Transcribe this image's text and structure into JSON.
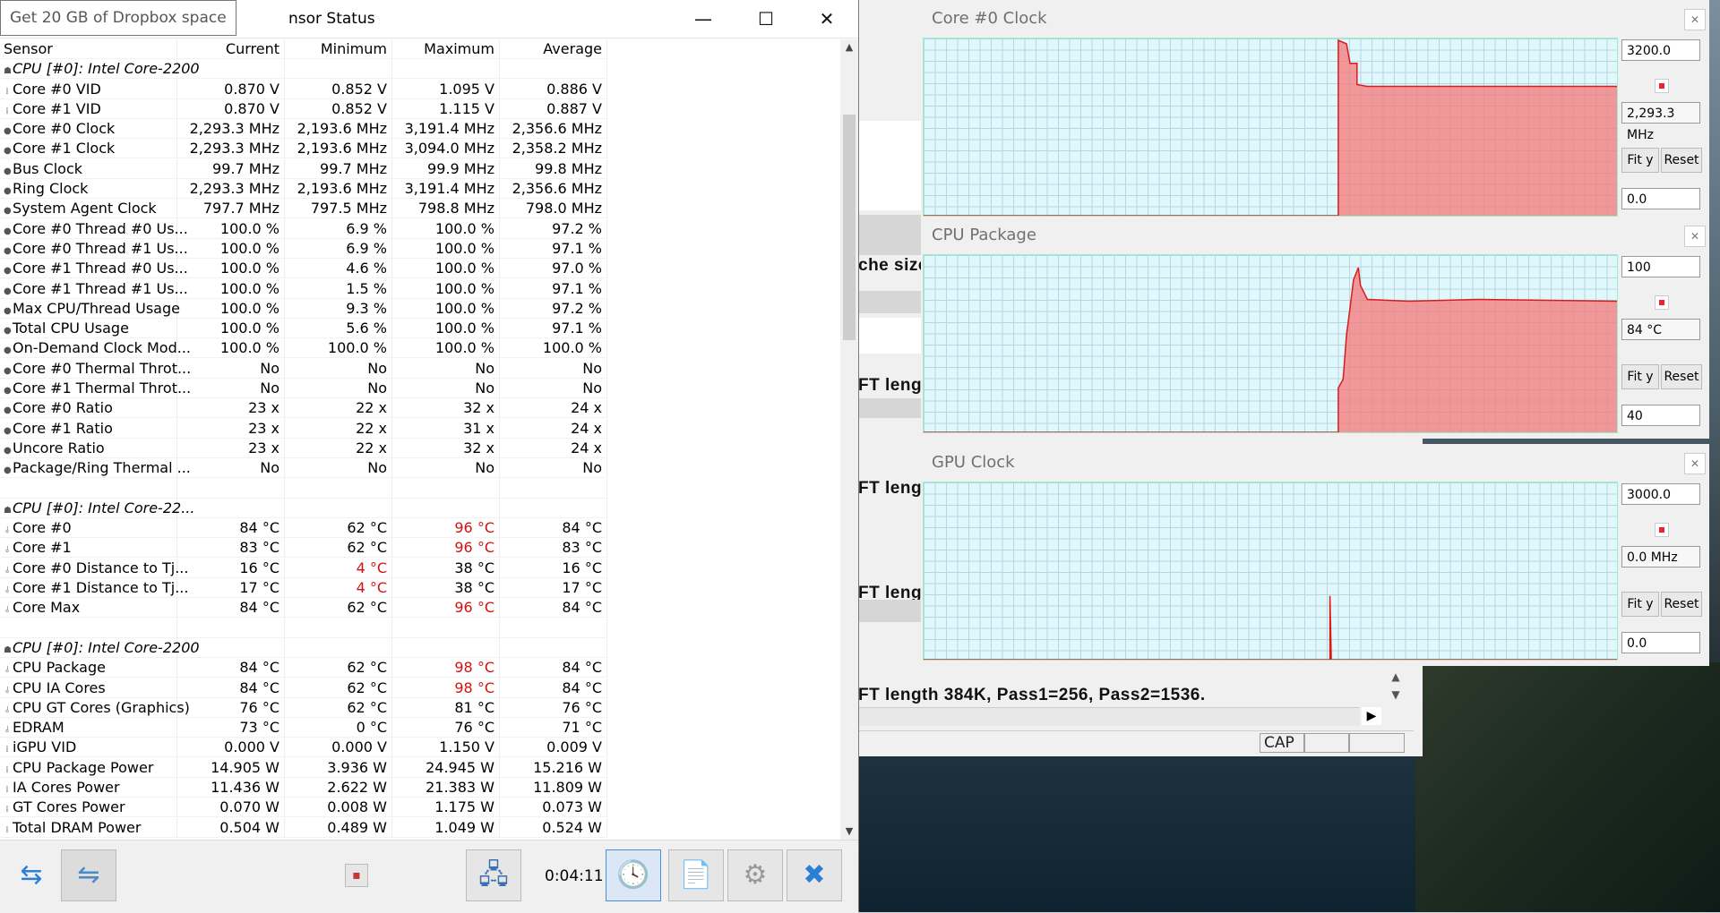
{
  "tooltip": "Get 20 GB of Dropbox space",
  "window_title": "nsor Status",
  "window_buttons": {
    "minimize": "—",
    "maximize": "☐",
    "close": "✕"
  },
  "columns": [
    "Sensor",
    "Current",
    "Minimum",
    "Maximum",
    "Average"
  ],
  "rows": [
    {
      "type": "group",
      "sensor": "CPU [#0]: Intel Core-2200",
      "current": "",
      "minimum": "",
      "maximum": "",
      "average": ""
    },
    {
      "type": "v",
      "sensor": "Core #0 VID",
      "current": "0.870 V",
      "minimum": "0.852 V",
      "maximum": "1.095 V",
      "average": "0.886 V"
    },
    {
      "type": "v",
      "sensor": "Core #1 VID",
      "current": "0.870 V",
      "minimum": "0.852 V",
      "maximum": "1.115 V",
      "average": "0.887 V"
    },
    {
      "type": "c",
      "sensor": "Core #0 Clock",
      "current": "2,293.3 MHz",
      "minimum": "2,193.6 MHz",
      "maximum": "3,191.4 MHz",
      "average": "2,356.6 MHz"
    },
    {
      "type": "c",
      "sensor": "Core #1 Clock",
      "current": "2,293.3 MHz",
      "minimum": "2,193.6 MHz",
      "maximum": "3,094.0 MHz",
      "average": "2,358.2 MHz"
    },
    {
      "type": "c",
      "sensor": "Bus Clock",
      "current": "99.7 MHz",
      "minimum": "99.7 MHz",
      "maximum": "99.9 MHz",
      "average": "99.8 MHz"
    },
    {
      "type": "c",
      "sensor": "Ring Clock",
      "current": "2,293.3 MHz",
      "minimum": "2,193.6 MHz",
      "maximum": "3,191.4 MHz",
      "average": "2,356.6 MHz"
    },
    {
      "type": "c",
      "sensor": "System Agent Clock",
      "current": "797.7 MHz",
      "minimum": "797.5 MHz",
      "maximum": "798.8 MHz",
      "average": "798.0 MHz"
    },
    {
      "type": "c",
      "sensor": "Core #0 Thread #0 Us...",
      "current": "100.0 %",
      "minimum": "6.9 %",
      "maximum": "100.0 %",
      "average": "97.2 %"
    },
    {
      "type": "c",
      "sensor": "Core #0 Thread #1 Us...",
      "current": "100.0 %",
      "minimum": "6.9 %",
      "maximum": "100.0 %",
      "average": "97.1 %"
    },
    {
      "type": "c",
      "sensor": "Core #1 Thread #0 Us...",
      "current": "100.0 %",
      "minimum": "4.6 %",
      "maximum": "100.0 %",
      "average": "97.0 %"
    },
    {
      "type": "c",
      "sensor": "Core #1 Thread #1 Us...",
      "current": "100.0 %",
      "minimum": "1.5 %",
      "maximum": "100.0 %",
      "average": "97.1 %"
    },
    {
      "type": "c",
      "sensor": "Max CPU/Thread Usage",
      "current": "100.0 %",
      "minimum": "9.3 %",
      "maximum": "100.0 %",
      "average": "97.2 %"
    },
    {
      "type": "c",
      "sensor": "Total CPU Usage",
      "current": "100.0 %",
      "minimum": "5.6 %",
      "maximum": "100.0 %",
      "average": "97.1 %"
    },
    {
      "type": "c",
      "sensor": "On-Demand Clock Mod...",
      "current": "100.0 %",
      "minimum": "100.0 %",
      "maximum": "100.0 %",
      "average": "100.0 %"
    },
    {
      "type": "c",
      "sensor": "Core #0 Thermal Throt...",
      "current": "No",
      "minimum": "No",
      "maximum": "No",
      "average": "No"
    },
    {
      "type": "c",
      "sensor": "Core #1 Thermal Throt...",
      "current": "No",
      "minimum": "No",
      "maximum": "No",
      "average": "No"
    },
    {
      "type": "c",
      "sensor": "Core #0 Ratio",
      "current": "23 x",
      "minimum": "22 x",
      "maximum": "32 x",
      "average": "24 x"
    },
    {
      "type": "c",
      "sensor": "Core #1 Ratio",
      "current": "23 x",
      "minimum": "22 x",
      "maximum": "31 x",
      "average": "24 x"
    },
    {
      "type": "c",
      "sensor": "Uncore Ratio",
      "current": "23 x",
      "minimum": "22 x",
      "maximum": "32 x",
      "average": "24 x"
    },
    {
      "type": "c",
      "sensor": "Package/Ring Thermal ...",
      "current": "No",
      "minimum": "No",
      "maximum": "No",
      "average": "No"
    },
    {
      "type": "blank",
      "sensor": "",
      "current": "",
      "minimum": "",
      "maximum": "",
      "average": ""
    },
    {
      "type": "group",
      "sensor": "CPU [#0]: Intel Core-22...",
      "current": "",
      "minimum": "",
      "maximum": "",
      "average": ""
    },
    {
      "type": "t",
      "sensor": "Core #0",
      "current": "84 °C",
      "minimum": "62 °C",
      "maximum": "96 °C",
      "average": "84 °C",
      "red": [
        "maximum"
      ]
    },
    {
      "type": "t",
      "sensor": "Core #1",
      "current": "83 °C",
      "minimum": "62 °C",
      "maximum": "96 °C",
      "average": "83 °C",
      "red": [
        "maximum"
      ]
    },
    {
      "type": "t",
      "sensor": "Core #0 Distance to Tj...",
      "current": "16 °C",
      "minimum": "4 °C",
      "maximum": "38 °C",
      "average": "16 °C",
      "red": [
        "minimum"
      ]
    },
    {
      "type": "t",
      "sensor": "Core #1 Distance to Tj...",
      "current": "17 °C",
      "minimum": "4 °C",
      "maximum": "38 °C",
      "average": "17 °C",
      "red": [
        "minimum"
      ]
    },
    {
      "type": "t",
      "sensor": "Core Max",
      "current": "84 °C",
      "minimum": "62 °C",
      "maximum": "96 °C",
      "average": "84 °C",
      "red": [
        "maximum"
      ]
    },
    {
      "type": "blank",
      "sensor": "",
      "current": "",
      "minimum": "",
      "maximum": "",
      "average": ""
    },
    {
      "type": "group",
      "sensor": "CPU [#0]: Intel Core-2200",
      "current": "",
      "minimum": "",
      "maximum": "",
      "average": ""
    },
    {
      "type": "t",
      "sensor": "CPU Package",
      "current": "84 °C",
      "minimum": "62 °C",
      "maximum": "98 °C",
      "average": "84 °C",
      "red": [
        "maximum"
      ]
    },
    {
      "type": "t",
      "sensor": "CPU IA Cores",
      "current": "84 °C",
      "minimum": "62 °C",
      "maximum": "98 °C",
      "average": "84 °C",
      "red": [
        "maximum"
      ]
    },
    {
      "type": "t",
      "sensor": "CPU GT Cores (Graphics)",
      "current": "76 °C",
      "minimum": "62 °C",
      "maximum": "81 °C",
      "average": "76 °C"
    },
    {
      "type": "t",
      "sensor": "EDRAM",
      "current": "73 °C",
      "minimum": "0 °C",
      "maximum": "76 °C",
      "average": "71 °C"
    },
    {
      "type": "v",
      "sensor": "iGPU VID",
      "current": "0.000 V",
      "minimum": "0.000 V",
      "maximum": "1.150 V",
      "average": "0.009 V"
    },
    {
      "type": "v",
      "sensor": "CPU Package Power",
      "current": "14.905 W",
      "minimum": "3.936 W",
      "maximum": "24.945 W",
      "average": "15.216 W"
    },
    {
      "type": "v",
      "sensor": "IA Cores Power",
      "current": "11.436 W",
      "minimum": "2.622 W",
      "maximum": "21.383 W",
      "average": "11.809 W"
    },
    {
      "type": "v",
      "sensor": "GT Cores Power",
      "current": "0.070 W",
      "minimum": "0.008 W",
      "maximum": "1.175 W",
      "average": "0.073 W"
    },
    {
      "type": "v",
      "sensor": "Total DRAM Power",
      "current": "0.504 W",
      "minimum": "0.489 W",
      "maximum": "1.049 W",
      "average": "0.524 W"
    }
  ],
  "toolbar": {
    "timer": "0:04:11",
    "small_button": "▪"
  },
  "bg_console": {
    "lines": [
      "che size",
      "FT leng",
      "FT leng",
      "FT leng",
      "FT length 384K, Pass1=256, Pass2=1536."
    ],
    "status_cap": "CAP"
  },
  "graphs": [
    {
      "title": "Core #0 Clock",
      "top_value": "3200.0",
      "current": "2,293.3 MHz",
      "bottom_value": "0.0",
      "fit_label": "Fit y",
      "reset_label": "Reset",
      "trace": [
        [
          0,
          0
        ],
        [
          0.598,
          0
        ],
        [
          0.598,
          0.99
        ],
        [
          0.61,
          0.97
        ],
        [
          0.615,
          0.86
        ],
        [
          0.625,
          0.86
        ],
        [
          0.625,
          0.74
        ],
        [
          0.64,
          0.73
        ],
        [
          1,
          0.73
        ]
      ]
    },
    {
      "title": "CPU Package",
      "top_value": "100",
      "current": "84 °C",
      "bottom_value": "40",
      "fit_label": "Fit y",
      "reset_label": "Reset",
      "trace": [
        [
          0,
          0
        ],
        [
          0.598,
          0
        ],
        [
          0.598,
          0.25
        ],
        [
          0.605,
          0.3
        ],
        [
          0.61,
          0.55
        ],
        [
          0.615,
          0.7
        ],
        [
          0.62,
          0.86
        ],
        [
          0.627,
          0.93
        ],
        [
          0.63,
          0.83
        ],
        [
          0.64,
          0.75
        ],
        [
          0.7,
          0.74
        ],
        [
          0.8,
          0.75
        ],
        [
          1,
          0.74
        ]
      ]
    },
    {
      "title": "GPU Clock",
      "top_value": "3000.0",
      "current": "0.0 MHz",
      "bottom_value": "0.0",
      "fit_label": "Fit y",
      "reset_label": "Reset",
      "trace": [
        [
          0,
          0
        ],
        [
          0.586,
          0
        ],
        [
          0.586,
          0.36
        ],
        [
          0.588,
          0
        ],
        [
          1,
          0
        ]
      ]
    }
  ]
}
